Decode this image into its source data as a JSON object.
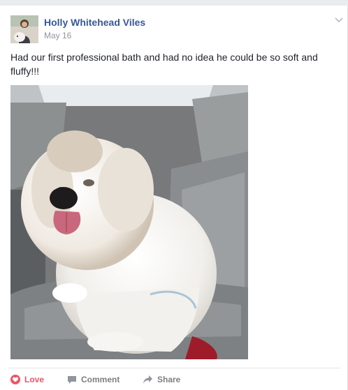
{
  "post": {
    "author": "Holly Whitehead Viles",
    "date": "May 16",
    "text": "Had our first professional bath and had no idea he could be so soft and fluffy!!!"
  },
  "actions": {
    "love": "Love",
    "comment": "Comment",
    "share": "Share"
  },
  "icons": {
    "love": "heart-icon",
    "comment": "comment-icon",
    "share": "share-arrow-icon",
    "menu": "chevron-down-icon"
  },
  "colors": {
    "author_link": "#365899",
    "love_active": "#f25268",
    "muted": "#90949c"
  }
}
